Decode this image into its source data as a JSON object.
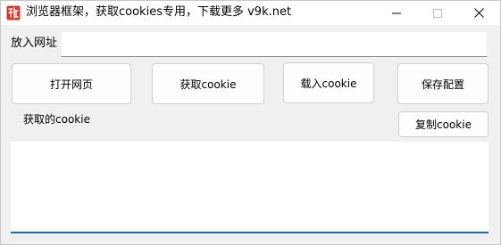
{
  "window": {
    "title": "浏览器框架，获取cookies专用，下载更多 v9k.net",
    "app_icon": "red-seal-icon",
    "controls": [
      "minimize-icon",
      "maximize-icon",
      "close-icon"
    ]
  },
  "url": {
    "label": "放入网址",
    "value": "",
    "placeholder": ""
  },
  "buttons": {
    "open_page": "打开网页",
    "get_cookie": "获取cookie",
    "load_cookie": "载入cookie",
    "save_config": "保存配置",
    "copy_cookie": "复制cookie"
  },
  "cookie": {
    "label": "获取的cookie",
    "value": ""
  },
  "colors": {
    "app_icon": "#d9342b",
    "focus_underline": "#1e6ba8"
  }
}
